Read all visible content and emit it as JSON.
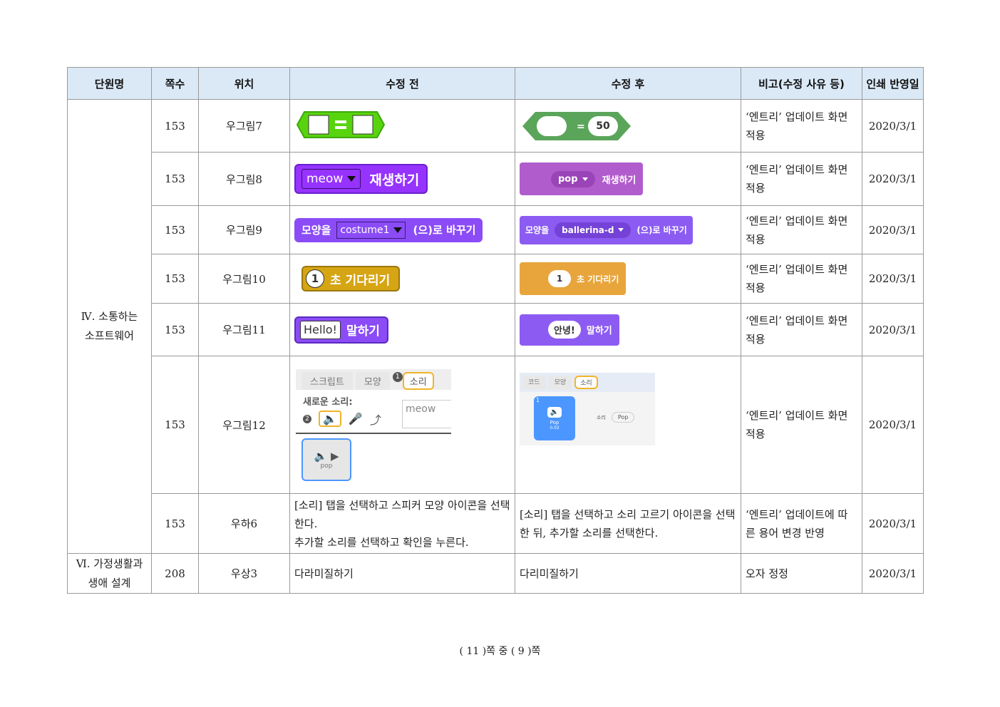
{
  "headers": [
    "단원명",
    "쪽수",
    "위치",
    "수정 전",
    "수정 후",
    "비고(수정 사유 등)",
    "인쇄 반영일"
  ],
  "unit1": [
    "Ⅳ. 소통하는",
    "소프트웨어"
  ],
  "unit2": [
    "Ⅵ. 가정생활과",
    "생애 설계"
  ],
  "rows": [
    {
      "page": "153",
      "loc": "우그림7",
      "note": "‘엔트리’ 업데이트 화면 적용",
      "date": "2020/3/1",
      "after": {
        "value": "50"
      }
    },
    {
      "page": "153",
      "loc": "우그림8",
      "note": "‘엔트리’ 업데이트 화면 적용",
      "date": "2020/3/1",
      "before": {
        "value": "meow",
        "label": "재생하기"
      },
      "after": {
        "value": "pop",
        "label": "재생하기"
      }
    },
    {
      "page": "153",
      "loc": "우그림9",
      "note": "‘엔트리’ 업데이트 화면 적용",
      "date": "2020/3/1",
      "before": {
        "prefix": "모양을",
        "value": "costume1",
        "label": "(으)로 바꾸기"
      },
      "after": {
        "prefix": "모양을",
        "value": "ballerina-d",
        "label": "(으)로 바꾸기"
      }
    },
    {
      "page": "153",
      "loc": "우그림10",
      "note": "‘엔트리’ 업데이트 화면 적용",
      "date": "2020/3/1",
      "before": {
        "value": "1",
        "label": "초 기다리기"
      },
      "after": {
        "value": "1",
        "label": "초 기다리기"
      }
    },
    {
      "page": "153",
      "loc": "우그림11",
      "note": "‘엔트리’ 업데이트 화면 적용",
      "date": "2020/3/1",
      "before": {
        "value": "Hello!",
        "label": "말하기"
      },
      "after": {
        "value": "안녕!",
        "label": "말하기"
      }
    },
    {
      "page": "153",
      "loc": "우그림12",
      "note": "‘엔트리’ 업데이트 화면 적용",
      "date": "2020/3/1",
      "before": {
        "tabs": [
          "스크립트",
          "모양",
          "소리"
        ],
        "num1": "1",
        "num2": "2",
        "new_sound": "새로운 소리:",
        "field": "meow",
        "thumb": "pop"
      },
      "after": {
        "tabs": [
          "코드",
          "모양",
          "소리"
        ],
        "num": "1",
        "sound_label": "소리",
        "sound_value": "Pop",
        "thumb_name": "Pop",
        "thumb_sub": "0.02"
      }
    },
    {
      "page": "153",
      "loc": "우하6",
      "date": "2020/3/1",
      "before_text": [
        "[소리] 탭을 선택하고 스피커 모양 아이콘을 선택한다.",
        "추가할 소리를 선택하고 확인을 누른다."
      ],
      "after_text": "[소리] 탭을 선택하고 소리 고르기 아이콘을 선택한 뒤, 추가할 소리를 선택한다.",
      "note": "‘엔트리’ 업데이트에 따른 용어 변경 반영"
    },
    {
      "page": "208",
      "loc": "우상3",
      "before_text": "다라미질하기",
      "after_text": "다리미질하기",
      "note": "오자 정정",
      "date": "2020/3/1"
    }
  ],
  "footer": "( 11 )쪽 중 ( 9 )쪽",
  "colors": {
    "header_bg": "#dbe9f7",
    "green": "#58d40e",
    "entry_green": "#5ba55a",
    "purple": "#9633ff",
    "entry_purple": "#b15ccc",
    "scratch_purple": "#8b4cf7",
    "yellow": "#d6a514",
    "entry_orange": "#e8a53b",
    "looks_purple": "#8c5cf2"
  }
}
